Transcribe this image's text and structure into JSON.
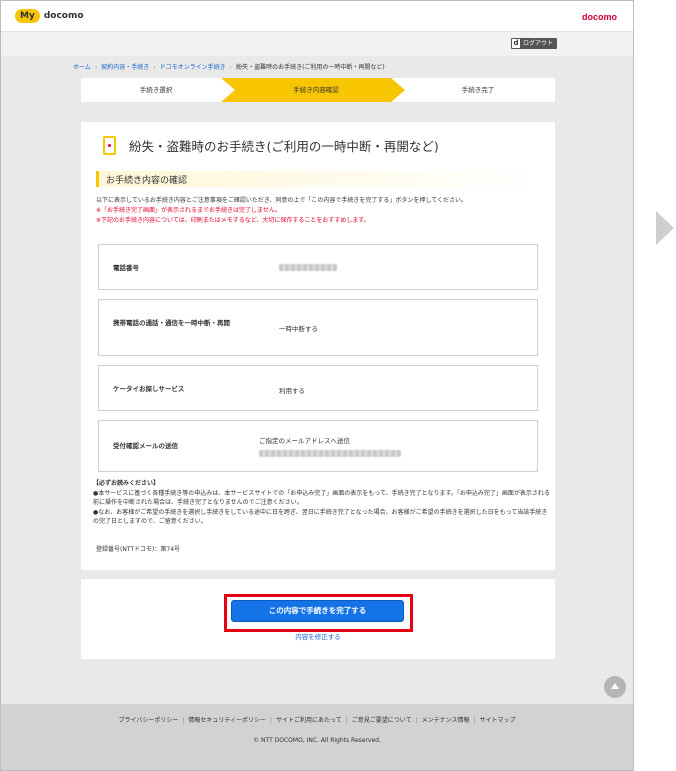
{
  "header": {
    "my_badge": "My",
    "my_text": "docomo",
    "brand": "docomo",
    "logout_icon": "d",
    "logout_label": "ログアウト"
  },
  "breadcrumb": [
    "ホーム",
    "契約内容・手続き",
    "ドコモオンライン手続き",
    "紛失・盗難時のお手続き(ご利用の一時中断・再開など)"
  ],
  "steps": [
    "手続き選択",
    "手続き内容確認",
    "手続き完了"
  ],
  "active_step": 1,
  "main": {
    "title": "紛失・盗難時のお手続き(ご利用の一時中断・再開など)",
    "section_title": "お手続き内容の確認",
    "intro": "以下に表示しているお手続き内容とご注意事項をご確認いただき、同意の上で「この内容で手続きを完了する」ボタンを押してください。",
    "warnings": [
      "※「お手続き完了画面」が表示されるまでお手続きは完了しません。",
      "※下記のお手続き内容については、印刷またはメモするなど、大切に保存することをおすすめします。"
    ],
    "rows": [
      {
        "label": "電話番号",
        "value": ""
      },
      {
        "label": "携帯電話の通話・通信を一時中断・再開",
        "value": "一時中断する"
      },
      {
        "label": "ケータイお探しサービス",
        "value": "利用する"
      },
      {
        "label": "受付確認メールの送信",
        "value": "ご指定のメールアドレスへ送信"
      }
    ],
    "notice_title": "【必ずお読みください】",
    "notice_lines": [
      "●本サービスに基づく各種手続き等の申込みは、本サービスサイトでの「お申込み完了」画面の表示をもって、手続き完了となります。「お申込み完了」画面が表示される前に操作を中断された場合は、手続き完了となりませんのでご注意ください。",
      "●なお、お客様がご希望の手続きを選択し手続きをしている途中に日を跨ぎ、翌日に手続き完了となった場合、お客様がご希望の手続きを選択した日をもって当該手続きの完了日としますので、ご留意ください。"
    ],
    "registration": "登録番号(NTTドコモ)：第74号"
  },
  "actions": {
    "complete_button": "この内容で手続きを完了する",
    "modify_link": "内容を修正する"
  },
  "footer": {
    "links": [
      "プライバシーポリシー",
      "情報セキュリティーポリシー",
      "サイトご利用にあたって",
      "ご意見ご要望について",
      "メンテナンス情報",
      "サイトマップ"
    ],
    "copyright": "© NTT DOCOMO, INC. All Rights Reserved."
  },
  "colors": {
    "accent": "#f7c600",
    "primary_button": "#1473e6",
    "highlight": "#e60012",
    "link": "#1a66cc",
    "warning": "#e8002d"
  },
  "icons": [
    "smartphone-icon",
    "scroll-top-icon",
    "next-arrow-icon",
    "d-account-icon"
  ]
}
